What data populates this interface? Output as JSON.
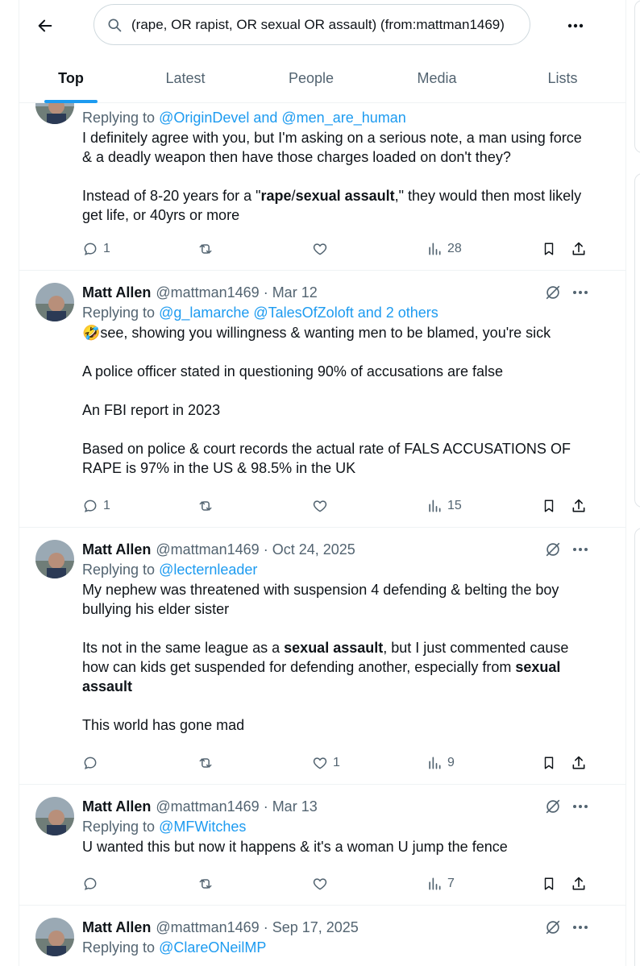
{
  "search": {
    "query": "(rape, OR rapist, OR sexual OR assault) (from:mattman1469)"
  },
  "tabs": [
    "Top",
    "Latest",
    "People",
    "Media",
    "Lists"
  ],
  "tweets": [
    {
      "name": "",
      "handle": "",
      "time": "",
      "reply_prefix": "Replying to ",
      "reply_targets": "@OriginDevel and @men_are_human",
      "paragraphs": [
        "I definitely agree with you, but I'm asking on a serious note, a man using force & a deadly weapon then have those charges loaded on don't they?",
        "Instead of 8-20 years for a \"rape/sexual assault,\"  they would then most likely get life, or 40yrs or more"
      ],
      "replies": "1",
      "reposts": "",
      "likes": "",
      "views": "28"
    },
    {
      "name": "Matt Allen",
      "handle": "@mattman1469",
      "time": "Mar 12",
      "reply_prefix": "Replying to ",
      "reply_targets": "@g_lamarche @TalesOfZoloft and 2 others",
      "paragraphs": [
        "🤣see, showing you willingness & wanting men to be blamed, you're sick",
        "A police officer stated in questioning 90% of accusations are false",
        "An FBI report in 2023",
        "Based on police & court records the actual rate of FALS ACCUSATIONS OF RAPE is 97% in the US & 98.5% in the UK"
      ],
      "replies": "1",
      "reposts": "",
      "likes": "",
      "views": "15"
    },
    {
      "name": "Matt Allen",
      "handle": "@mattman1469",
      "time": "Oct 24, 2025",
      "reply_prefix": "Replying to ",
      "reply_targets": "@lecternleader",
      "paragraphs": [
        "My nephew was threatened with suspension 4 defending & belting the boy bullying his elder sister",
        "Its not in the same league as a sexual assault, but I just commented cause how can kids get suspended for defending another, especially from sexual assault",
        "This world has gone mad"
      ],
      "replies": "",
      "reposts": "",
      "likes": "1",
      "views": "9"
    },
    {
      "name": "Matt Allen",
      "handle": "@mattman1469",
      "time": "Mar 13",
      "reply_prefix": "Replying to ",
      "reply_targets": "@MFWitches",
      "paragraphs": [
        "U wanted this but now it happens & it's a woman U jump the fence"
      ],
      "replies": "",
      "reposts": "",
      "likes": "",
      "views": "7"
    },
    {
      "name": "Matt Allen",
      "handle": "@mattman1469",
      "time": "Sep 17, 2025",
      "reply_prefix": "Replying to ",
      "reply_targets": "@ClareONeilMP",
      "paragraphs": [],
      "replies": "",
      "reposts": "",
      "likes": "",
      "views": ""
    }
  ],
  "colors": {
    "accent": "#1d9bf0",
    "muted": "#536471",
    "text": "#0f1419",
    "border": "#eff3f4"
  }
}
